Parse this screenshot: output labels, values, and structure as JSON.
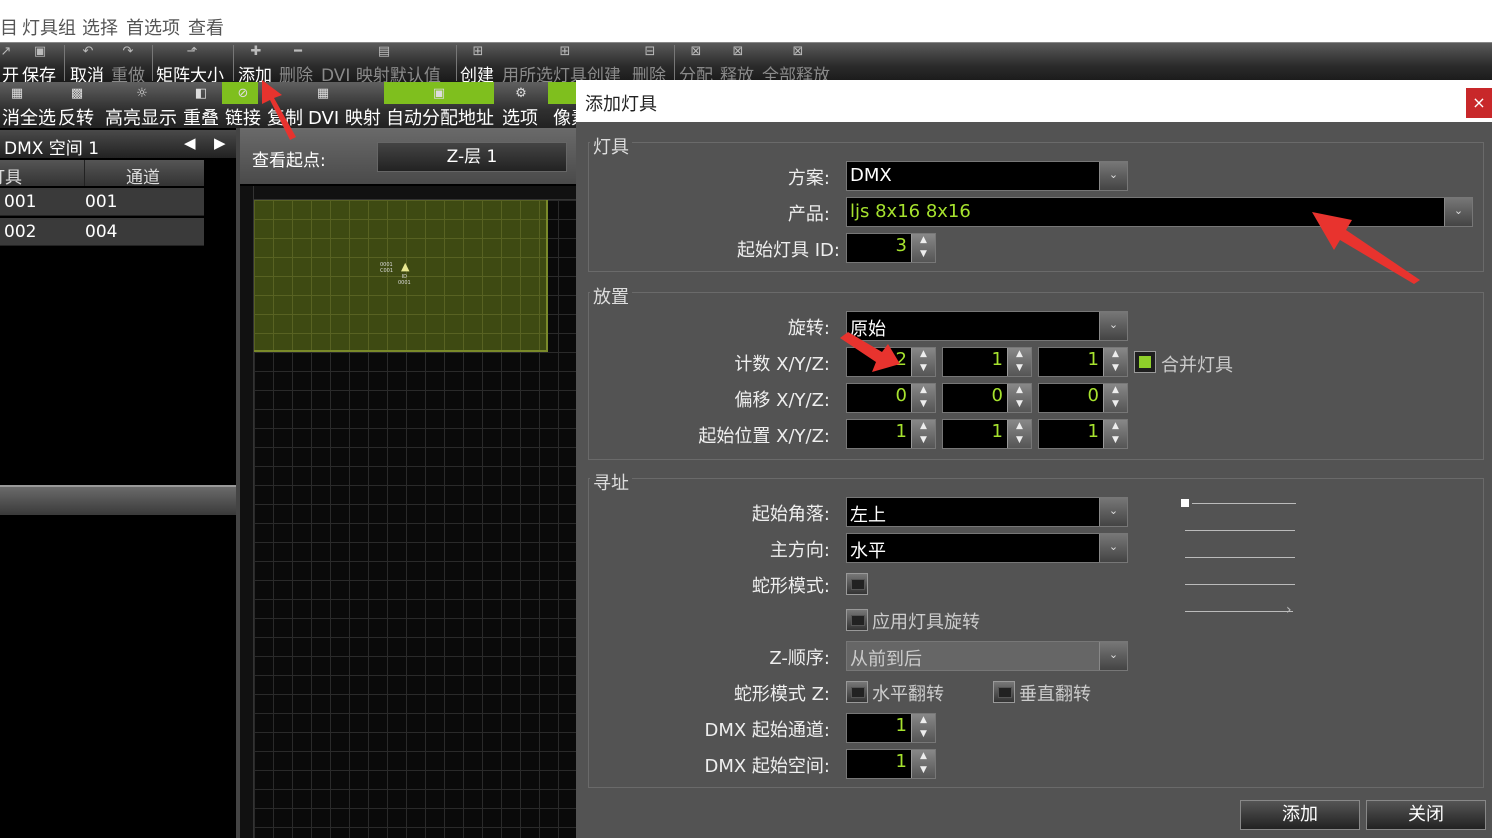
{
  "menubar": {
    "items": [
      "目",
      "灯具组",
      "选择",
      "首选项",
      "查看"
    ]
  },
  "toolbar1": {
    "items": [
      {
        "label": "开",
        "icon": "open-icon",
        "enabled": true
      },
      {
        "label": "保存",
        "icon": "save-icon",
        "enabled": true
      },
      {
        "label": "取消",
        "icon": "undo-icon",
        "enabled": true
      },
      {
        "label": "重做",
        "icon": "redo-icon",
        "enabled": false
      },
      {
        "label": "矩阵大小",
        "icon": "matrix-size-icon",
        "enabled": true
      },
      {
        "label": "添加",
        "icon": "plus-icon",
        "enabled": true
      },
      {
        "label": "删除",
        "icon": "minus-icon",
        "enabled": false
      },
      {
        "label": "DVI 映射默认值",
        "icon": "dvi-icon",
        "enabled": false
      },
      {
        "label": "创建",
        "icon": "create-icon",
        "enabled": true
      },
      {
        "label": "用所选灯具创建",
        "icon": "create-from-selection-icon",
        "enabled": false
      },
      {
        "label": "删除",
        "icon": "delete-group-icon",
        "enabled": false
      },
      {
        "label": "分配",
        "icon": "assign-icon",
        "enabled": false
      },
      {
        "label": "释放",
        "icon": "release-icon",
        "enabled": false
      },
      {
        "label": "全部释放",
        "icon": "release-all-icon",
        "enabled": false
      }
    ]
  },
  "toolbar2": {
    "items": [
      {
        "label": "消全选",
        "icon": "grid-icon"
      },
      {
        "label": "反转",
        "icon": "invert-icon"
      },
      {
        "label": "高亮显示",
        "icon": "bulb-icon"
      },
      {
        "label": "重叠",
        "icon": "overlap-icon"
      },
      {
        "label": "链接",
        "icon": "link-icon"
      },
      {
        "label": "复制",
        "icon": "copy-icon"
      },
      {
        "label": "DVI 映射",
        "icon": "dvi-map-icon"
      },
      {
        "label": "自动分配地址",
        "icon": "auto-address-icon"
      },
      {
        "label": "选项",
        "icon": "gear-icon"
      },
      {
        "label": "像素",
        "icon": "pixel-icon"
      }
    ]
  },
  "left": {
    "dmx_space": "DMX 空间 1",
    "col_fixture": "灯具",
    "col_channel": "通道",
    "rows": [
      {
        "fixture": "001",
        "channel": "001"
      },
      {
        "fixture": "002",
        "channel": "004"
      }
    ]
  },
  "view": {
    "start_label": "查看起点:",
    "layer": "Z-层 1",
    "fixture_labels": [
      "0001",
      "C001",
      "ID",
      "0001"
    ]
  },
  "dialog": {
    "title": "添加灯具",
    "close": "×",
    "group_fixture": "灯具",
    "scheme_label": "方案:",
    "scheme_value": "DMX",
    "product_label": "产品:",
    "product_value": "ljs 8x16 8x16",
    "start_id_label": "起始灯具 ID:",
    "start_id_value": "3",
    "group_placement": "放置",
    "rotation_label": "旋转:",
    "rotation_value": "原始",
    "count_label": "计数 X/Y/Z:",
    "count": [
      "2",
      "1",
      "1"
    ],
    "merge_label": "合并灯具",
    "offset_label": "偏移 X/Y/Z:",
    "offset": [
      "0",
      "0",
      "0"
    ],
    "startpos_label": "起始位置 X/Y/Z:",
    "startpos": [
      "1",
      "1",
      "1"
    ],
    "group_addressing": "寻址",
    "corner_label": "起始角落:",
    "corner_value": "左上",
    "direction_label": "主方向:",
    "direction_value": "水平",
    "snake_label": "蛇形模式:",
    "apply_rotation_label": "应用灯具旋转",
    "zorder_label": "Z-顺序:",
    "zorder_value": "从前到后",
    "snakez_label": "蛇形模式 Z:",
    "hflip_label": "水平翻转",
    "vflip_label": "垂直翻转",
    "dmx_channel_label": "DMX 起始通道:",
    "dmx_channel_value": "1",
    "dmx_universe_label": "DMX 起始空间:",
    "dmx_universe_value": "1",
    "add_button": "添加",
    "close_button": "关闭"
  },
  "colors": {
    "accent_green": "#8fcf2a",
    "text_green": "#a6e22e",
    "close_red": "#c8282a",
    "arrow_red": "#e8332e"
  }
}
